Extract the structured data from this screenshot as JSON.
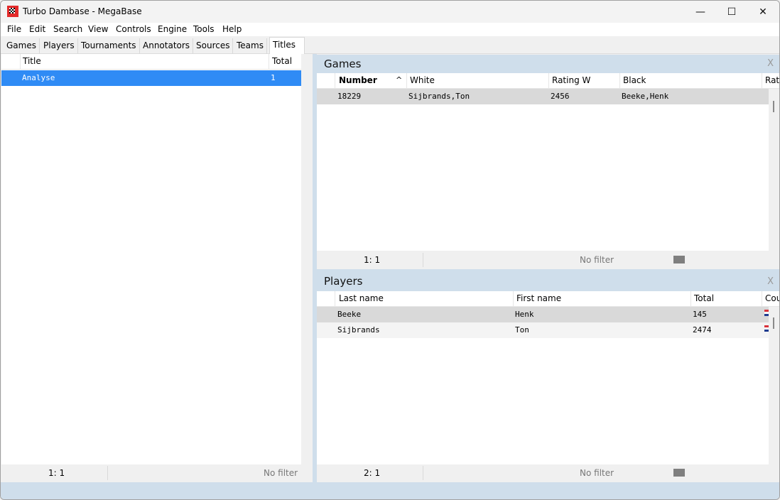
{
  "window": {
    "title": "Turbo Dambase - MegaBase",
    "controls": {
      "minimize": "—",
      "maximize": "☐",
      "close": "✕"
    }
  },
  "menu": [
    "File",
    "Edit",
    "Search",
    "View",
    "Controls",
    "Engine",
    "Tools",
    "Help"
  ],
  "tabs": [
    {
      "label": "Games",
      "active": false
    },
    {
      "label": "Players",
      "active": false
    },
    {
      "label": "Tournaments",
      "active": false
    },
    {
      "label": "Annotators",
      "active": false
    },
    {
      "label": "Sources",
      "active": false
    },
    {
      "label": "Teams",
      "active": false
    },
    {
      "label": "Titles",
      "active": true
    }
  ],
  "titles_list": {
    "columns": [
      "Title",
      "Total"
    ],
    "rows": [
      {
        "title": "Analyse",
        "total": "1",
        "selected": true
      }
    ],
    "status": {
      "count": "1: 1",
      "filter": "No filter"
    }
  },
  "games_panel": {
    "title": "Games",
    "close": "X",
    "columns": [
      "Number",
      "White",
      "Rating W",
      "Black",
      "Rati"
    ],
    "sort_indicator": "^",
    "rows": [
      {
        "number": "18229",
        "white": "Sijbrands,Ton",
        "rating_w": "2456",
        "black": "Beeke,Henk"
      }
    ],
    "status": {
      "count": "1: 1",
      "filter": "No filter"
    }
  },
  "players_panel": {
    "title": "Players",
    "close": "X",
    "columns": [
      "Last name",
      "First name",
      "Total",
      "Cou"
    ],
    "rows": [
      {
        "last": "Beeke",
        "first": "Henk",
        "total": "145",
        "country_flag": "netherlands-flag"
      },
      {
        "last": "Sijbrands",
        "first": "Ton",
        "total": "2474",
        "country_flag": "netherlands-flag"
      }
    ],
    "status": {
      "count": "2: 1",
      "filter": "No filter"
    }
  }
}
